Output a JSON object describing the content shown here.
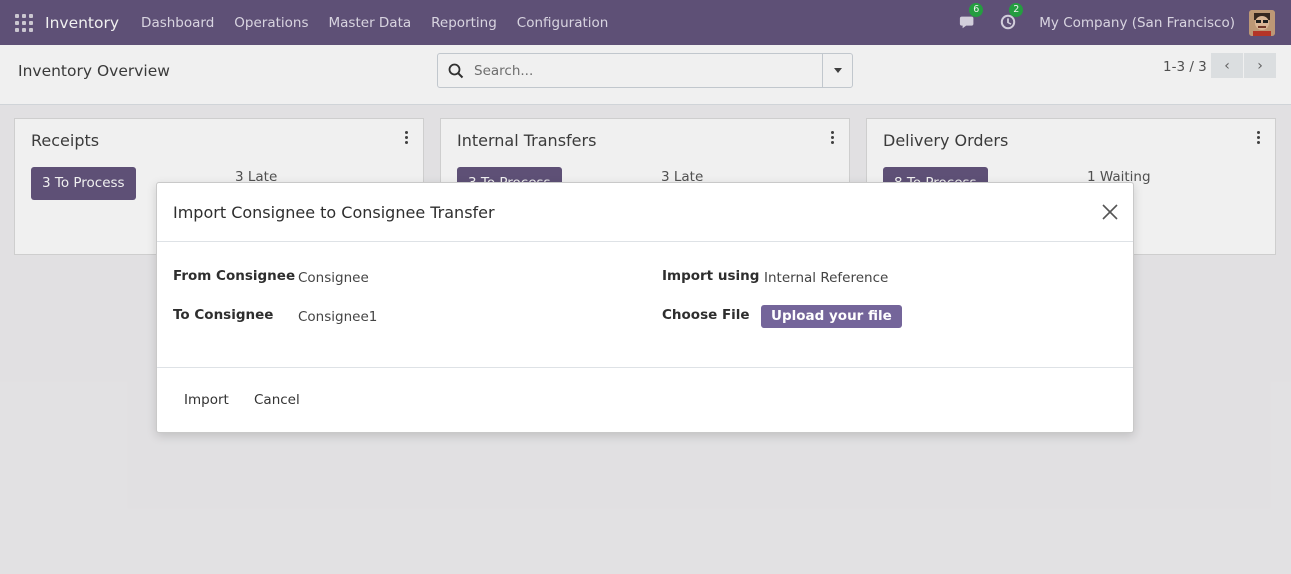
{
  "navbar": {
    "app_name": "Inventory",
    "menu": [
      "Dashboard",
      "Operations",
      "Master Data",
      "Reporting",
      "Configuration"
    ],
    "messages_count": "6",
    "activities_count": "2",
    "company": "My Company (San Francisco)",
    "icons": [
      "apps-grid-icon",
      "chat-icon",
      "clock-icon",
      "avatar"
    ],
    "accent_color": "#64557e",
    "badge_color": "#28a745"
  },
  "control_panel": {
    "title": "Inventory Overview",
    "search_placeholder": "Search...",
    "pager": "1-3 / 3",
    "prev": "‹",
    "next": "›"
  },
  "cards": [
    {
      "title": "Receipts",
      "button": "3 To Process",
      "status": "3 Late"
    },
    {
      "title": "Internal Transfers",
      "button": "3 To Process",
      "status": "3 Late"
    },
    {
      "title": "Delivery Orders",
      "button": "8 To Process",
      "status": "1 Waiting"
    }
  ],
  "modal": {
    "title": "Import Consignee to Consignee Transfer",
    "from_label": "From Consignee",
    "from_value": "Consignee",
    "to_label": "To Consignee",
    "to_value": "Consignee1",
    "import_using_label": "Import using",
    "import_using_value": "Internal Reference",
    "choose_file_label": "Choose File",
    "upload_label": "Upload your file",
    "import_button": "Import",
    "cancel_button": "Cancel"
  }
}
